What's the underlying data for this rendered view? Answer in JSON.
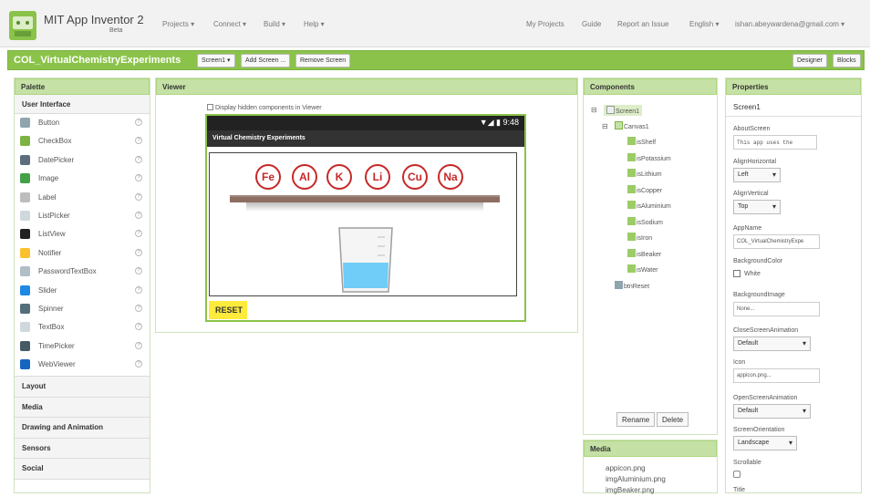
{
  "app": {
    "name": "MIT App Inventor 2",
    "beta": "Beta"
  },
  "nav": {
    "projects": "Projects ▾",
    "connect": "Connect ▾",
    "build": "Build ▾",
    "help": "Help ▾",
    "my_projects": "My Projects",
    "guide": "Guide",
    "report": "Report an Issue",
    "language": "English ▾",
    "account": "ishan.abeywardena@gmail.com ▾"
  },
  "toolbar": {
    "project": "COL_VirtualChemistryExperiments",
    "screen_select": "Screen1 ▾",
    "add_screen": "Add Screen ...",
    "remove_screen": "Remove Screen",
    "designer": "Designer",
    "blocks": "Blocks"
  },
  "palette": {
    "title": "Palette",
    "section_ui": "User Interface",
    "items": [
      {
        "label": "Button",
        "color": "#90a4ae"
      },
      {
        "label": "CheckBox",
        "color": "#7cb342"
      },
      {
        "label": "DatePicker",
        "color": "#5d6d7e"
      },
      {
        "label": "Image",
        "color": "#43a047"
      },
      {
        "label": "Label",
        "color": "#bdbdbd"
      },
      {
        "label": "ListPicker",
        "color": "#cfd8dc"
      },
      {
        "label": "ListView",
        "color": "#212121"
      },
      {
        "label": "Notifier",
        "color": "#fbc02d"
      },
      {
        "label": "PasswordTextBox",
        "color": "#b0bec5"
      },
      {
        "label": "Slider",
        "color": "#1e88e5"
      },
      {
        "label": "Spinner",
        "color": "#546e7a"
      },
      {
        "label": "TextBox",
        "color": "#cfd8dc"
      },
      {
        "label": "TimePicker",
        "color": "#455a64"
      },
      {
        "label": "WebViewer",
        "color": "#1565c0"
      }
    ],
    "help": "?",
    "sections": [
      "Layout",
      "Media",
      "Drawing and Animation",
      "Sensors",
      "Social"
    ]
  },
  "viewer": {
    "title": "Viewer",
    "hidden_label": "Display hidden components in Viewer",
    "status_time": "▼◢ ▮ 9:48",
    "app_title": "Virtual Chemistry Experiments",
    "elements": [
      "Fe",
      "Al",
      "K",
      "Li",
      "Cu",
      "Na"
    ],
    "reset": "RESET"
  },
  "components": {
    "title": "Components",
    "screen": "Screen1",
    "canvas": "Canvas1",
    "children": [
      "isShelf",
      "isPotassium",
      "isLithium",
      "isCopper",
      "isAluminium",
      "isSodium",
      "isIron",
      "isBeaker",
      "isWater"
    ],
    "reset_btn": "btnReset",
    "rename": "Rename",
    "delete": "Delete"
  },
  "media": {
    "title": "Media",
    "files": [
      "appicon.png",
      "imgAluminium.png",
      "imgBeaker.png"
    ]
  },
  "properties": {
    "title": "Properties",
    "component": "Screen1",
    "about_label": "AboutScreen",
    "about_value": "This app uses the",
    "align_h_label": "AlignHorizontal",
    "align_h_value": "Left",
    "align_v_label": "AlignVertical",
    "align_v_value": "Top",
    "appname_label": "AppName",
    "appname_value": "COL_VirtualChemistryExpe",
    "bgcolor_label": "BackgroundColor",
    "bgcolor_value": "White",
    "bgimage_label": "BackgroundImage",
    "bgimage_value": "None...",
    "close_anim_label": "CloseScreenAnimation",
    "close_anim_value": "Default",
    "icon_label": "Icon",
    "icon_value": "appicon.png...",
    "open_anim_label": "OpenScreenAnimation",
    "open_anim_value": "Default",
    "orientation_label": "ScreenOrientation",
    "orientation_value": "Landscape",
    "scrollable_label": "Scrollable",
    "title_label": "Title"
  }
}
